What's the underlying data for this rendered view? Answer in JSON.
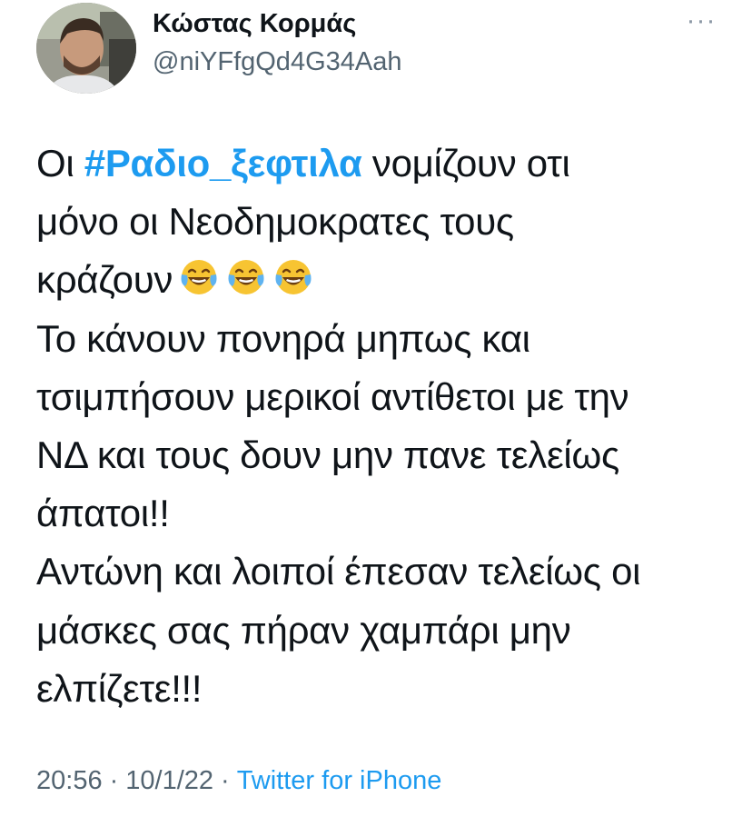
{
  "author": {
    "name": "Κώστας Κορμάς",
    "handle": "@niYFfgQd4G34Aah"
  },
  "menu": {
    "more_icon": "more-horizontal-icon",
    "more_label": "···"
  },
  "tweet": {
    "lines": [
      {
        "parts": [
          {
            "text": "Οι "
          },
          {
            "text": "#Ραδιο_ξεφτιλα",
            "hashtag": true
          },
          {
            "text": " νομίζουν οτι"
          }
        ]
      },
      {
        "parts": [
          {
            "text": "μόνο οι Νεοδημοκρατες τους"
          }
        ]
      },
      {
        "parts": [
          {
            "text": "κράζουν"
          }
        ],
        "emojis": [
          "face-with-tears-of-joy",
          "face-with-tears-of-joy",
          "face-with-tears-of-joy"
        ]
      },
      {
        "parts": [
          {
            "text": "Το κάνουν πονηρά μηπως και"
          }
        ]
      },
      {
        "parts": [
          {
            "text": "τσιμπήσουν μερικοί αντίθετοι με την"
          }
        ]
      },
      {
        "parts": [
          {
            "text": "ΝΔ και τους δουν μην πανε τελείως"
          }
        ]
      },
      {
        "parts": [
          {
            "text": "άπατοι!!"
          }
        ]
      },
      {
        "parts": [
          {
            "text": "Αντώνη και λοιποί έπεσαν τελείως οι"
          }
        ]
      },
      {
        "parts": [
          {
            "text": "μάσκες σας πήραν χαμπάρι μην"
          }
        ]
      },
      {
        "parts": [
          {
            "text": "ελπίζετε!!!"
          }
        ]
      }
    ]
  },
  "meta": {
    "time": "20:56",
    "separator": "·",
    "date": "10/1/22",
    "source": "Twitter for iPhone"
  },
  "colors": {
    "accent": "#1d9bf0",
    "secondary_text": "#536471",
    "primary_text": "#0f1419"
  }
}
